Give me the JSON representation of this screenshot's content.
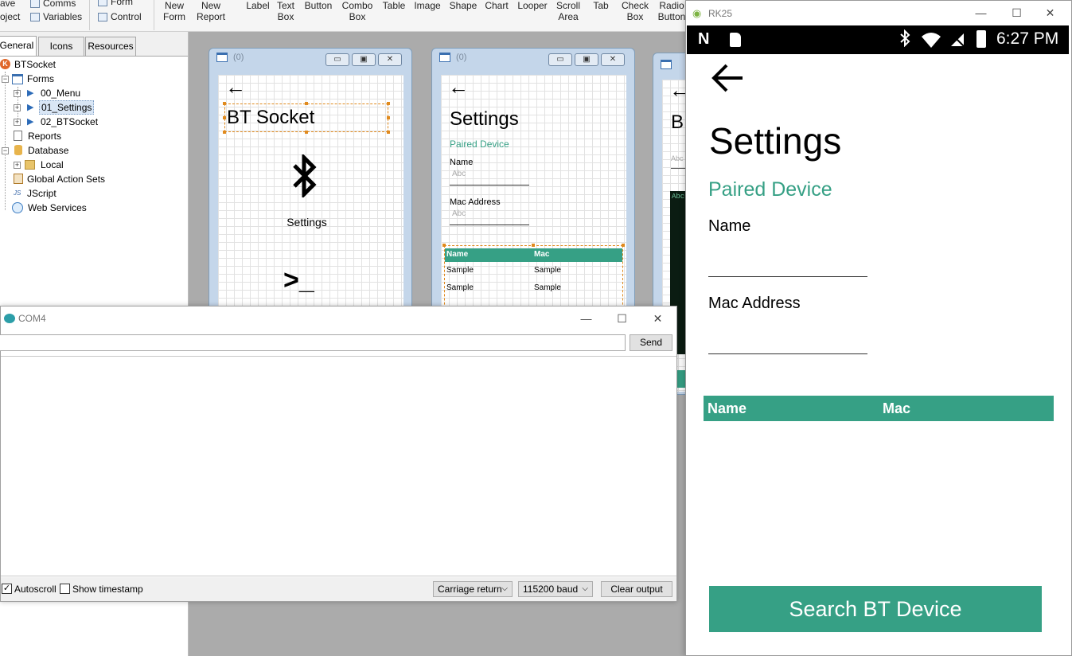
{
  "ribbon": {
    "left_top": [
      "ave",
      "Comms"
    ],
    "left_bottom": [
      "oject",
      "Variables"
    ],
    "form_label": "Form",
    "control_label": "Control",
    "items": [
      "New\nForm",
      "New\nReport",
      "Label",
      "Text\nBox",
      "Button",
      "Combo\nBox",
      "Table",
      "Image",
      "Shape",
      "Chart",
      "Looper",
      "Scroll\nArea",
      "Tab",
      "Check\nBox",
      "Radio\nButton"
    ]
  },
  "left_panel": {
    "tabs": [
      "General",
      "Icons",
      "Resources"
    ],
    "tree": {
      "project": "BTSocket",
      "forms": "Forms",
      "form_items": [
        "00_Menu",
        "01_Settings",
        "02_BTSocket"
      ],
      "reports": "Reports",
      "database": "Database",
      "local": "Local",
      "global_action_sets": "Global Action Sets",
      "jscript": "JScript",
      "web_services": "Web Services"
    }
  },
  "designer": {
    "form1": {
      "title": "(0)",
      "heading": "BT Socket",
      "settings_label": "Settings",
      "terminal_glyph": ">_"
    },
    "form2": {
      "title": "(0)",
      "heading": "Settings",
      "paired_device": "Paired Device",
      "name_label": "Name",
      "name_placeholder": "Abc",
      "mac_label": "Mac Address",
      "mac_placeholder": "Abc",
      "table_headers": [
        "Name",
        "Mac"
      ],
      "table_rows": [
        [
          "Sample",
          "Sample"
        ],
        [
          "Sample",
          "Sample"
        ]
      ]
    },
    "form3": {
      "heading_partial": "B",
      "field_placeholder": "Abc",
      "console_placeholder": "Abc"
    }
  },
  "serial_monitor": {
    "title": "COM4",
    "input_value": "",
    "send_label": "Send",
    "autoscroll_label": "Autoscroll",
    "autoscroll_checked": true,
    "timestamp_label": "Show timestamp",
    "timestamp_checked": false,
    "line_ending": "Carriage return",
    "baud": "115200 baud",
    "clear_label": "Clear output"
  },
  "emulator": {
    "title": "RK25",
    "status_time": "6:27 PM",
    "screen": {
      "heading": "Settings",
      "paired_device": "Paired Device",
      "name_label": "Name",
      "name_value": "",
      "mac_label": "Mac Address",
      "mac_value": "",
      "table_headers": [
        "Name",
        "Mac"
      ],
      "search_button": "Search BT Device"
    }
  },
  "colors": {
    "accent_teal": "#36a085",
    "designer_bg": "#ababab",
    "form_frame": "#c4d6ea",
    "selection_orange": "#e08a1e"
  }
}
